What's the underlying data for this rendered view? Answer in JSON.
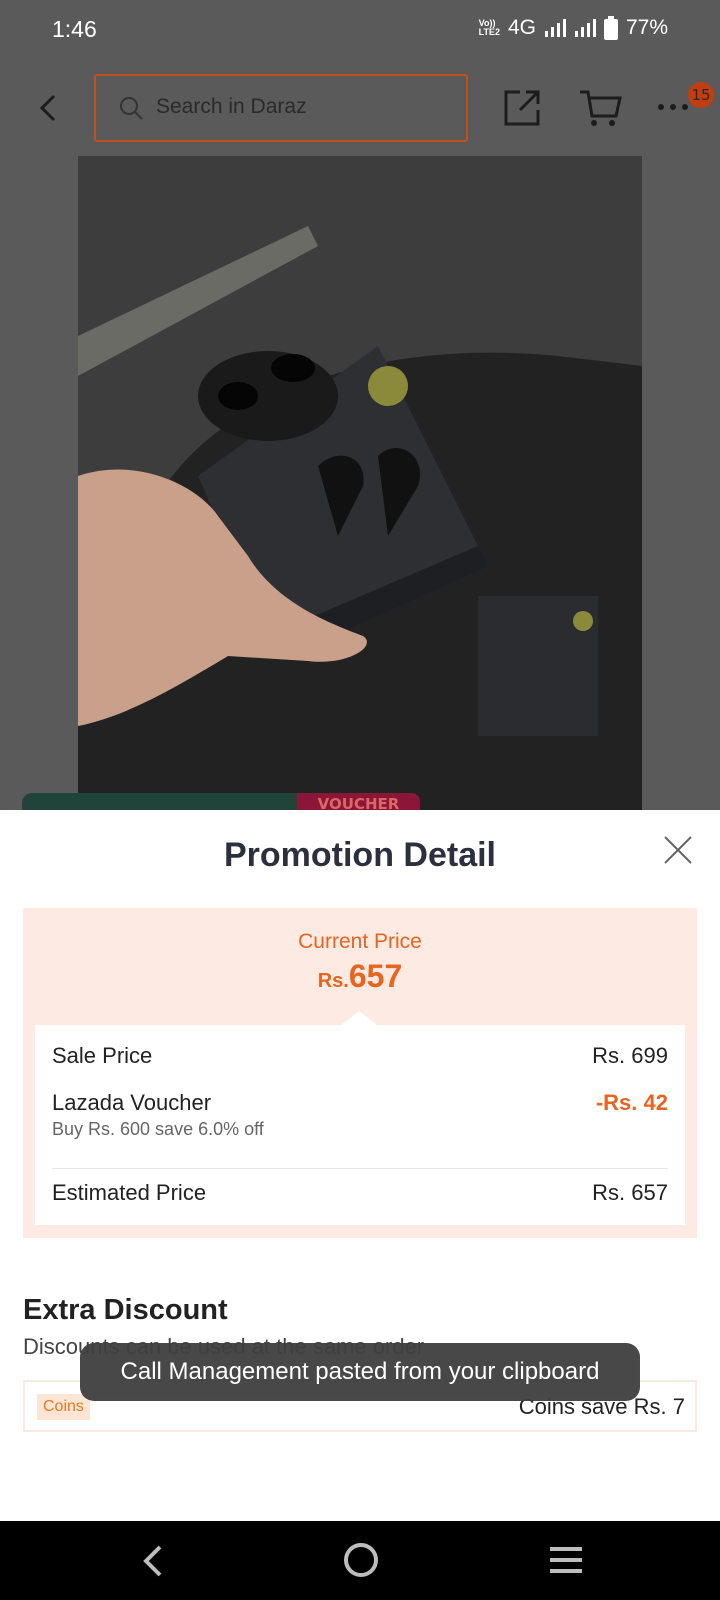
{
  "status_bar": {
    "time": "1:46",
    "volte_top": "Vo))",
    "volte_bottom": "LTE2",
    "network": "4G",
    "battery": "77%"
  },
  "top_bar": {
    "search_placeholder": "Search in Daraz",
    "cart_badge": "15"
  },
  "promo_tab_text": "VOUCHER",
  "sheet": {
    "title": "Promotion Detail",
    "current_price_label": "Current Price",
    "current_price_currency": "Rs.",
    "current_price_value": "657",
    "rows": {
      "sale_label": "Sale Price",
      "sale_value": "Rs. 699",
      "voucher_label": "Lazada Voucher",
      "voucher_value": "-Rs. 42",
      "voucher_sub": "Buy Rs. 600 save 6.0% off",
      "estimated_label": "Estimated Price",
      "estimated_value": "Rs. 657"
    },
    "extra": {
      "title": "Extra Discount",
      "subtitle": "Discounts can be used at the same order",
      "coins_tag": "Coins",
      "coins_save": "Coins save Rs. 7"
    }
  },
  "toast": "Call Management pasted from your clipboard",
  "colors": {
    "accent": "#e8641f",
    "panel_bg": "#fdeae2",
    "overlay": "#5a5a5a"
  }
}
